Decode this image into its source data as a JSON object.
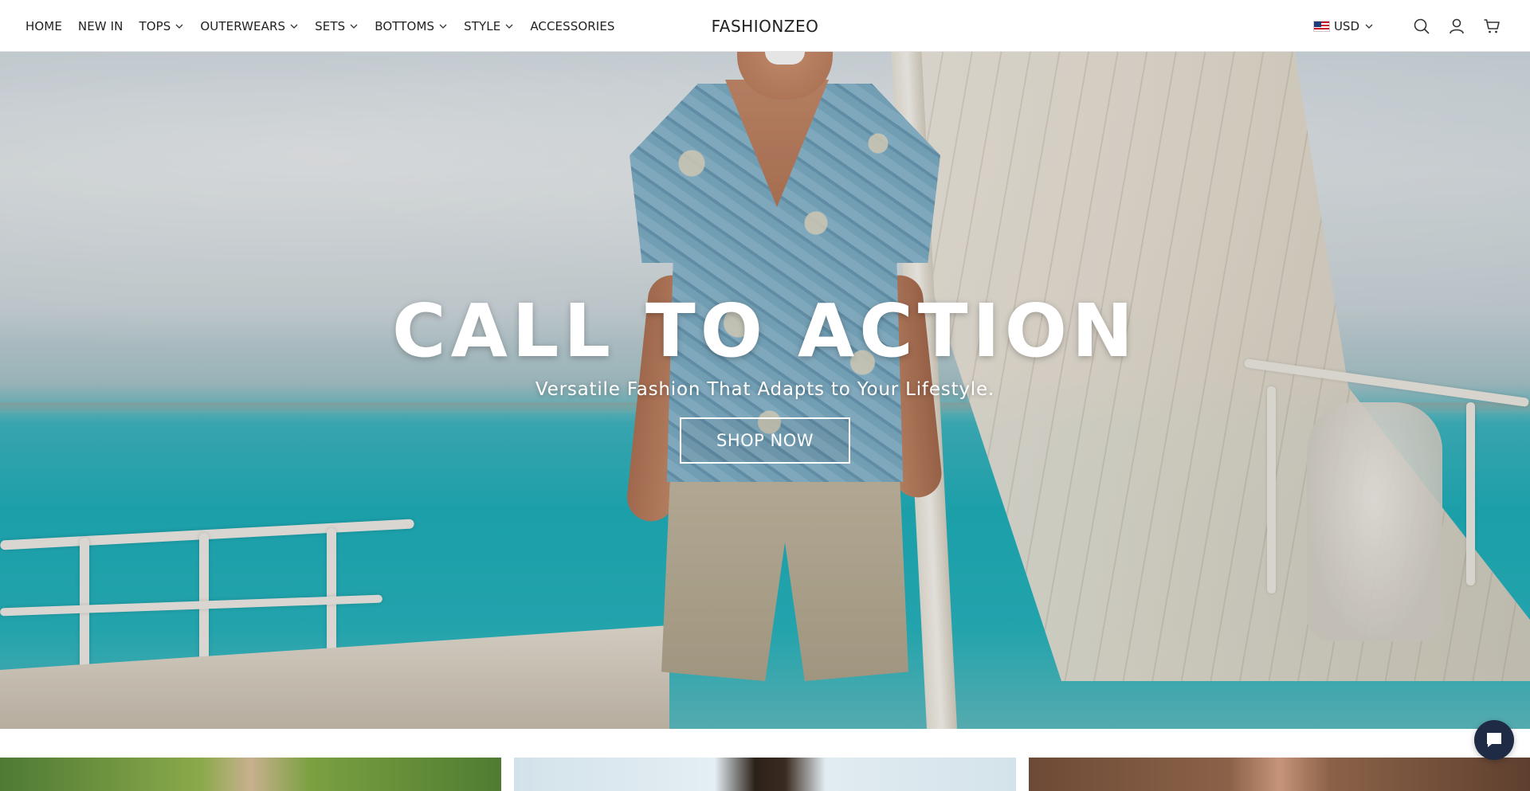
{
  "header": {
    "nav": [
      {
        "label": "HOME",
        "has_dropdown": false
      },
      {
        "label": "NEW IN",
        "has_dropdown": false
      },
      {
        "label": "TOPS",
        "has_dropdown": true
      },
      {
        "label": "OUTERWEARS",
        "has_dropdown": true
      },
      {
        "label": "SETS",
        "has_dropdown": true
      },
      {
        "label": "BOTTOMS",
        "has_dropdown": true
      },
      {
        "label": "STYLE",
        "has_dropdown": true
      },
      {
        "label": "ACCESSORIES",
        "has_dropdown": false
      }
    ],
    "logo": "FASHIONZEO",
    "currency": {
      "code": "USD",
      "flag": "us-flag-icon"
    },
    "icons": [
      "search-icon",
      "account-icon",
      "cart-icon"
    ]
  },
  "hero": {
    "title": "CALL TO ACTION",
    "subtitle": "Versatile Fashion That Adapts to Your Lifestyle.",
    "button_label": "SHOP NOW"
  },
  "chat": {
    "icon": "chat-bubble-icon"
  },
  "colors": {
    "chat_button": "#1f2a44",
    "text": "#222222",
    "header_bg": "#ffffff"
  }
}
